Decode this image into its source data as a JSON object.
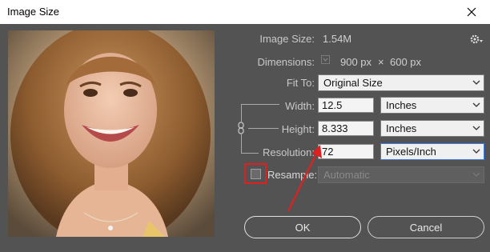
{
  "window": {
    "title": "Image Size"
  },
  "info": {
    "image_size_label": "Image Size:",
    "image_size_value": "1.54M",
    "dimensions_label": "Dimensions:",
    "dim_width": "900 px",
    "dim_times": "×",
    "dim_height": "600 px"
  },
  "fit_to": {
    "label": "Fit To:",
    "value": "Original Size"
  },
  "width": {
    "label": "Width:",
    "value": "12.5",
    "unit": "Inches"
  },
  "height": {
    "label": "Height:",
    "value": "8.333",
    "unit": "Inches"
  },
  "resolution": {
    "label": "Resolution:",
    "value": "72",
    "unit": "Pixels/Inch"
  },
  "resample": {
    "label": "Resample:",
    "value": "Automatic",
    "checked": false
  },
  "buttons": {
    "ok": "OK",
    "cancel": "Cancel"
  },
  "colors": {
    "dialog_bg": "#535353",
    "highlight": "#e02020",
    "focus": "#3a7ee8"
  },
  "icons": [
    "close-icon",
    "gear-icon",
    "chain-link-icon",
    "chevron-down-icon",
    "annotation-arrow"
  ]
}
